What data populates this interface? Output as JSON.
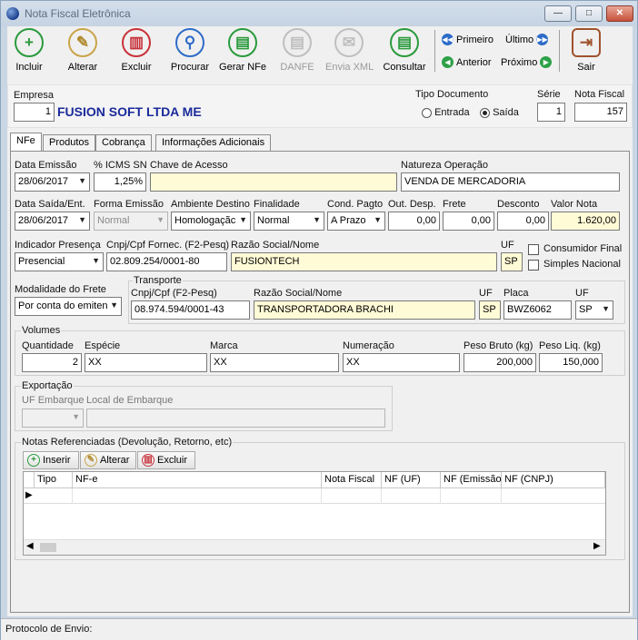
{
  "window": {
    "title": "Nota Fiscal Eletrônica",
    "min_label": "—",
    "max_label": "□",
    "close_label": "✕"
  },
  "toolbar": {
    "buttons": [
      {
        "label": "Incluir",
        "icon": "+"
      },
      {
        "label": "Alterar",
        "icon": "✎"
      },
      {
        "label": "Excluir",
        "icon": "🗑"
      },
      {
        "label": "Procurar",
        "icon": "⌕"
      },
      {
        "label": "Gerar NFe",
        "icon": "▤"
      },
      {
        "label": "DANFE",
        "icon": "▤"
      },
      {
        "label": "Envia XML",
        "icon": "✉"
      },
      {
        "label": "Consultar",
        "icon": "▤"
      },
      {
        "label": "Sair",
        "icon": "⇥"
      }
    ],
    "nav": {
      "first": "Primeiro",
      "last": "Último",
      "prev": "Anterior",
      "next": "Próximo"
    }
  },
  "header": {
    "empresa_label": "Empresa",
    "empresa_code": "1",
    "empresa_name": "FUSION SOFT LTDA ME",
    "tipo_label": "Tipo Documento",
    "entrada_label": "Entrada",
    "saida_label": "Saída",
    "serie_label": "Série",
    "serie_value": "1",
    "nota_label": "Nota Fiscal",
    "nota_value": "157"
  },
  "tabs": [
    "NFe",
    "Produtos",
    "Cobrança",
    "Informações Adicionais"
  ],
  "form": {
    "data_emissao_label": "Data Emissão",
    "data_emissao": "28/06/2017",
    "icms_label": "% ICMS SN",
    "icms": "1,25%",
    "chave_label": "Chave de Acesso",
    "chave": "",
    "natureza_label": "Natureza Operação",
    "natureza": "VENDA DE MERCADORIA",
    "data_saida_label": "Data Saída/Ent.",
    "data_saida": "28/06/2017",
    "forma_label": "Forma Emissão",
    "forma": "Normal",
    "ambiente_label": "Ambiente Destino",
    "ambiente": "Homologaçãc",
    "finalidade_label": "Finalidade",
    "finalidade": "Normal",
    "cond_label": "Cond. Pagto",
    "cond": "A Prazo",
    "out_label": "Out. Desp.",
    "out": "0,00",
    "frete_label": "Frete",
    "frete": "0,00",
    "desconto_label": "Desconto",
    "desconto": "0,00",
    "valor_label": "Valor Nota",
    "valor": "1.620,00",
    "presenca_label": "Indicador Presença",
    "presenca": "Presencial",
    "cnpj_label": "Cnpj/Cpf Fornec. (F2-Pesq)",
    "cnpj": "02.809.254/0001-80",
    "razao_label": "Razão Social/Nome",
    "razao": "FUSIONTECH",
    "uf_label": "UF",
    "uf": "SP",
    "consumidor_label": "Consumidor Final",
    "simples_label": "Simples Nacional",
    "modalidade_label": "Modalidade do Frete",
    "modalidade": "Por conta do emiten",
    "transporte_label": "Transporte",
    "t_cnpj_label": "Cnpj/Cpf (F2-Pesq)",
    "t_cnpj": "08.974.594/0001-43",
    "t_razao_label": "Razão Social/Nome",
    "t_razao": "TRANSPORTADORA BRACHI",
    "t_uf_label": "UF",
    "t_uf": "SP",
    "placa_label": "Placa",
    "placa": "BWZ6062",
    "placa_uf_label": "UF",
    "placa_uf": "SP",
    "volumes_label": "Volumes",
    "qtd_label": "Quantidade",
    "qtd": "2",
    "especie_label": "Espécie",
    "especie": "XX",
    "marca_label": "Marca",
    "marca": "XX",
    "numeracao_label": "Numeração",
    "numeracao": "XX",
    "peso_bruto_label": "Peso Bruto (kg)",
    "peso_bruto": "200,000",
    "peso_liq_label": "Peso Liq. (kg)",
    "peso_liq": "150,000",
    "exportacao_label": "Exportação",
    "uf_emb_label": "UF Embarque",
    "local_emb_label": "Local de Embarque",
    "notas_label": "Notas Referenciadas (Devolução, Retorno, etc)",
    "inserir": "Inserir",
    "alterar": "Alterar",
    "excluir": "Excluir",
    "cols": [
      "Tipo",
      "NF-e",
      "Nota Fiscal",
      "NF (UF)",
      "NF (Emissão)",
      "NF (CNPJ)"
    ]
  },
  "status": {
    "protocolo_label": "Protocolo de Envio:"
  }
}
